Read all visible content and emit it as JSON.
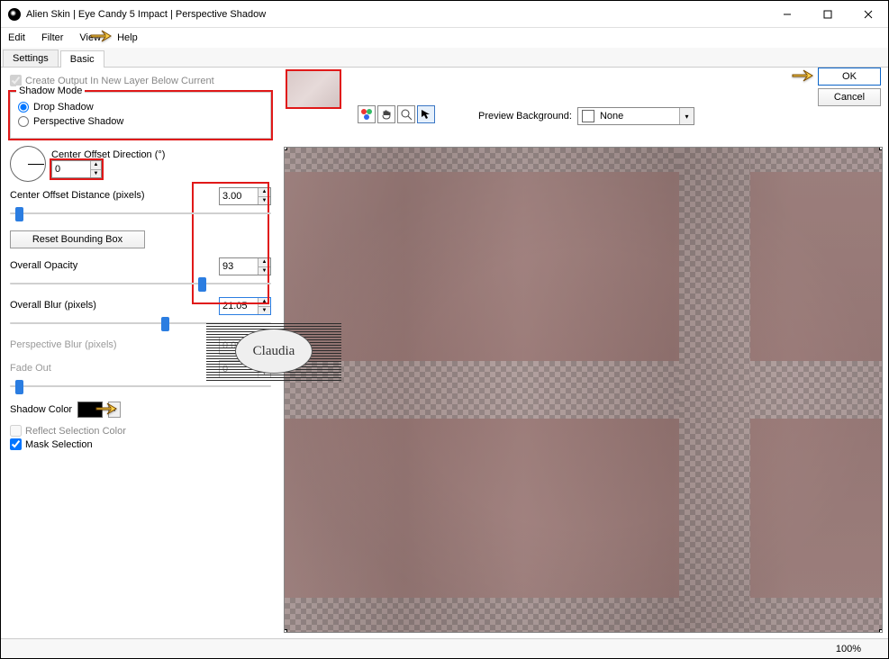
{
  "window": {
    "title": "Alien Skin | Eye Candy 5 Impact | Perspective Shadow"
  },
  "menu": {
    "edit": "Edit",
    "filter": "Filter",
    "view": "View",
    "help": "Help"
  },
  "tabs": {
    "settings": "Settings",
    "basic": "Basic"
  },
  "checks": {
    "create_output": "Create Output In New Layer Below Current",
    "reflect": "Reflect Selection Color",
    "mask": "Mask Selection"
  },
  "group": {
    "legend": "Shadow Mode",
    "drop": "Drop Shadow",
    "persp": "Perspective Shadow"
  },
  "dir": {
    "label": "Center Offset Direction (°)",
    "value": "0"
  },
  "dist": {
    "label": "Center Offset Distance (pixels)",
    "value": "3.00"
  },
  "reset": "Reset Bounding Box",
  "opacity": {
    "label": "Overall Opacity",
    "value": "93"
  },
  "blur": {
    "label": "Overall Blur (pixels)",
    "value": "21.05"
  },
  "pblur": {
    "label": "Perspective Blur (pixels)",
    "value": "0.00"
  },
  "fade": {
    "label": "Fade Out",
    "value": "0"
  },
  "color": {
    "label": "Shadow Color"
  },
  "prevbg": {
    "label": "Preview Background:",
    "value": "None"
  },
  "buttons": {
    "ok": "OK",
    "cancel": "Cancel"
  },
  "status": {
    "zoom": "100%"
  },
  "stamp": "Claudia"
}
